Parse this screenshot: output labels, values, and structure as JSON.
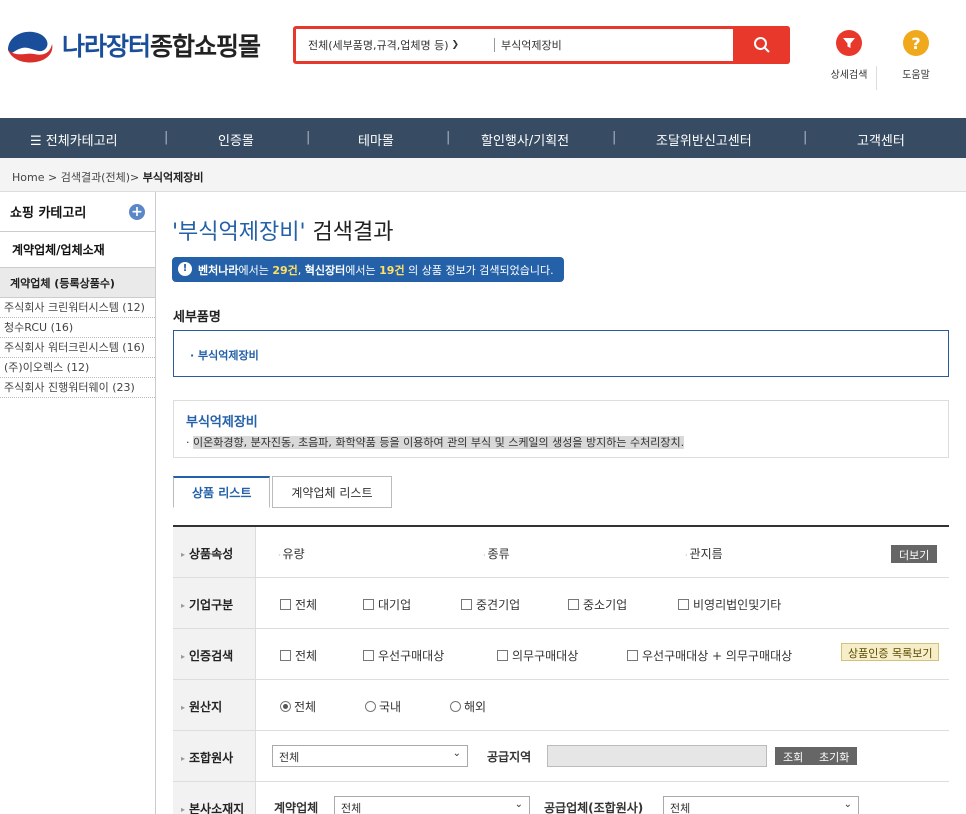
{
  "header": {
    "logo_part1": "나라장터",
    "logo_part2": "종합쇼핑몰",
    "search_scope": "전체(세부품명,규격,업체명 등)",
    "search_value": "부식억제장비",
    "detail_search_label": "상세검색",
    "help_label": "도움말",
    "help_glyph": "?"
  },
  "nav": {
    "items": [
      "전체카테고리",
      "인증몰",
      "테마몰",
      "할인행사/기획전",
      "조달위반신고센터",
      "고객센터"
    ],
    "separator": "|"
  },
  "breadcrumb": {
    "home": "Home",
    "level1": "검색결과(전체)",
    "current": "부식억제장비",
    "sep": ">"
  },
  "sidebar": {
    "shopping_category": "쇼핑 카테고리",
    "plus_glyph": "+",
    "contract_vendors": "계약업체/업체소재",
    "sub_header": "계약업체 (등록상품수)",
    "items": [
      "주식회사 크린워터시스템 (12)",
      "청수RCU (16)",
      "주식회사 워터크린시스템 (16)",
      "(주)이오렉스 (12)",
      "주식회사 진행워터웨이 (23)"
    ]
  },
  "main": {
    "title_query": "'부식억제장비'",
    "title_suffix": "검색결과",
    "info": {
      "icon": "!",
      "venture": "벤처나라",
      "t1": "에서는",
      "venture_count": "29건",
      "innov": "혁신장터",
      "t2": "에서는",
      "innov_count": "19건",
      "t3": "의 상품 정보가 검색되었습니다."
    },
    "section_label": "세부품명",
    "category_item": "· 부식억제장비",
    "desc_title": "부식억제장비",
    "desc_text": "이온화경향, 분자진동, 초음파, 화학약품 등을 이용하여 관의 부식 및 스케일의 생성을 방지하는 수처리장치.",
    "tabs": [
      "상품 리스트",
      "계약업체 리스트"
    ]
  },
  "filters": {
    "attr": {
      "label": "상품속성",
      "opts": [
        "유량",
        "종류",
        "관지름"
      ],
      "more": "더보기"
    },
    "company": {
      "label": "기업구분",
      "opts": [
        "전체",
        "대기업",
        "중견기업",
        "중소기업",
        "비영리법인및기타"
      ]
    },
    "cert": {
      "label": "인증검색",
      "opts": [
        "전체",
        "우선구매대상",
        "의무구매대상",
        "우선구매대상 + 의무구매대상"
      ],
      "btn": "상품인증 목록보기"
    },
    "origin": {
      "label": "원산지",
      "opts": [
        "전체",
        "국내",
        "해외"
      ]
    },
    "union": {
      "label": "조합원사",
      "select": "전체",
      "region_label": "공급지역",
      "search_btn": "조회",
      "reset_btn": "초기화"
    },
    "hq": {
      "label": "본사소재지",
      "contract_label": "계약업체",
      "contract_select": "전체",
      "supplier_label": "공급업체(조합원사)",
      "supplier_select": "전체"
    }
  },
  "colors": {
    "brand_blue": "#1a4e9b",
    "search_red": "#e8382c",
    "nav_bg": "#374b63",
    "accent_blue": "#2461a8",
    "help_orange": "#f0a91d"
  }
}
